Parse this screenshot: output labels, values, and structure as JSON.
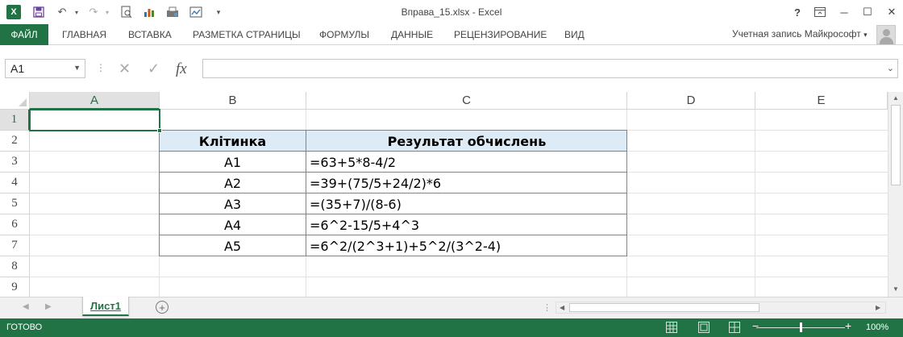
{
  "window": {
    "title": "Вправа_15.xlsx - Excel",
    "help_icon": "?",
    "ribbon_display_icon": "ribbon-display-icon",
    "minimize_icon": "─",
    "maximize_icon": "☐",
    "close_icon": "✕"
  },
  "quick_access": {
    "excel_icon": "X",
    "save_icon": "💾",
    "undo_icon": "↶",
    "redo_icon": "↷",
    "customize_icon": "▾"
  },
  "ribbon": {
    "file_tab": "ФАЙЛ",
    "tabs": [
      "ГЛАВНАЯ",
      "ВСТАВКА",
      "РАЗМЕТКА СТРАНИЦЫ",
      "ФОРМУЛЫ",
      "ДАННЫЕ",
      "РЕЦЕНЗИРОВАНИЕ",
      "ВИД"
    ],
    "account": "Учетная запись Майкрософт",
    "account_arrow": "▾"
  },
  "formula_bar": {
    "name_box": "A1",
    "name_box_arrow": "▼",
    "dots": "⋮",
    "cancel_icon": "✕",
    "enter_icon": "✓",
    "fx_label": "fx",
    "formula": "",
    "expand_icon": "⌄"
  },
  "grid": {
    "columns": [
      "A",
      "B",
      "C",
      "D",
      "E"
    ],
    "rows": [
      "1",
      "2",
      "3",
      "4",
      "5",
      "6",
      "7",
      "8",
      "9"
    ],
    "selected_cell": "A1"
  },
  "table": {
    "headers": [
      "Клітинка",
      "Результат обчислень"
    ],
    "rows": [
      [
        "A1",
        "=63+5*8-4/2"
      ],
      [
        "A2",
        "=39+(75/5+24/2)*6"
      ],
      [
        "A3",
        "=(35+7)/(8-6)"
      ],
      [
        "A4",
        "=6^2-15/5+4^3"
      ],
      [
        "A5",
        "=6^2/(2^3+1)+5^2/(3^2-4)"
      ]
    ],
    "header_fill": "#ddebf7",
    "border_color": "#31a3b7"
  },
  "sheet_tabs": {
    "active": "Лист1",
    "add_icon": "+",
    "nav_prev": "◀",
    "nav_next": "▶"
  },
  "status": {
    "ready": "ГОТОВО",
    "zoom_out": "−",
    "zoom_in": "+",
    "zoom_level": "100%",
    "zoom_percent": 100
  },
  "colors": {
    "accent": "#217346",
    "selected_header_bg": "#e1e1e1",
    "gridline": "#e2e2e2"
  }
}
